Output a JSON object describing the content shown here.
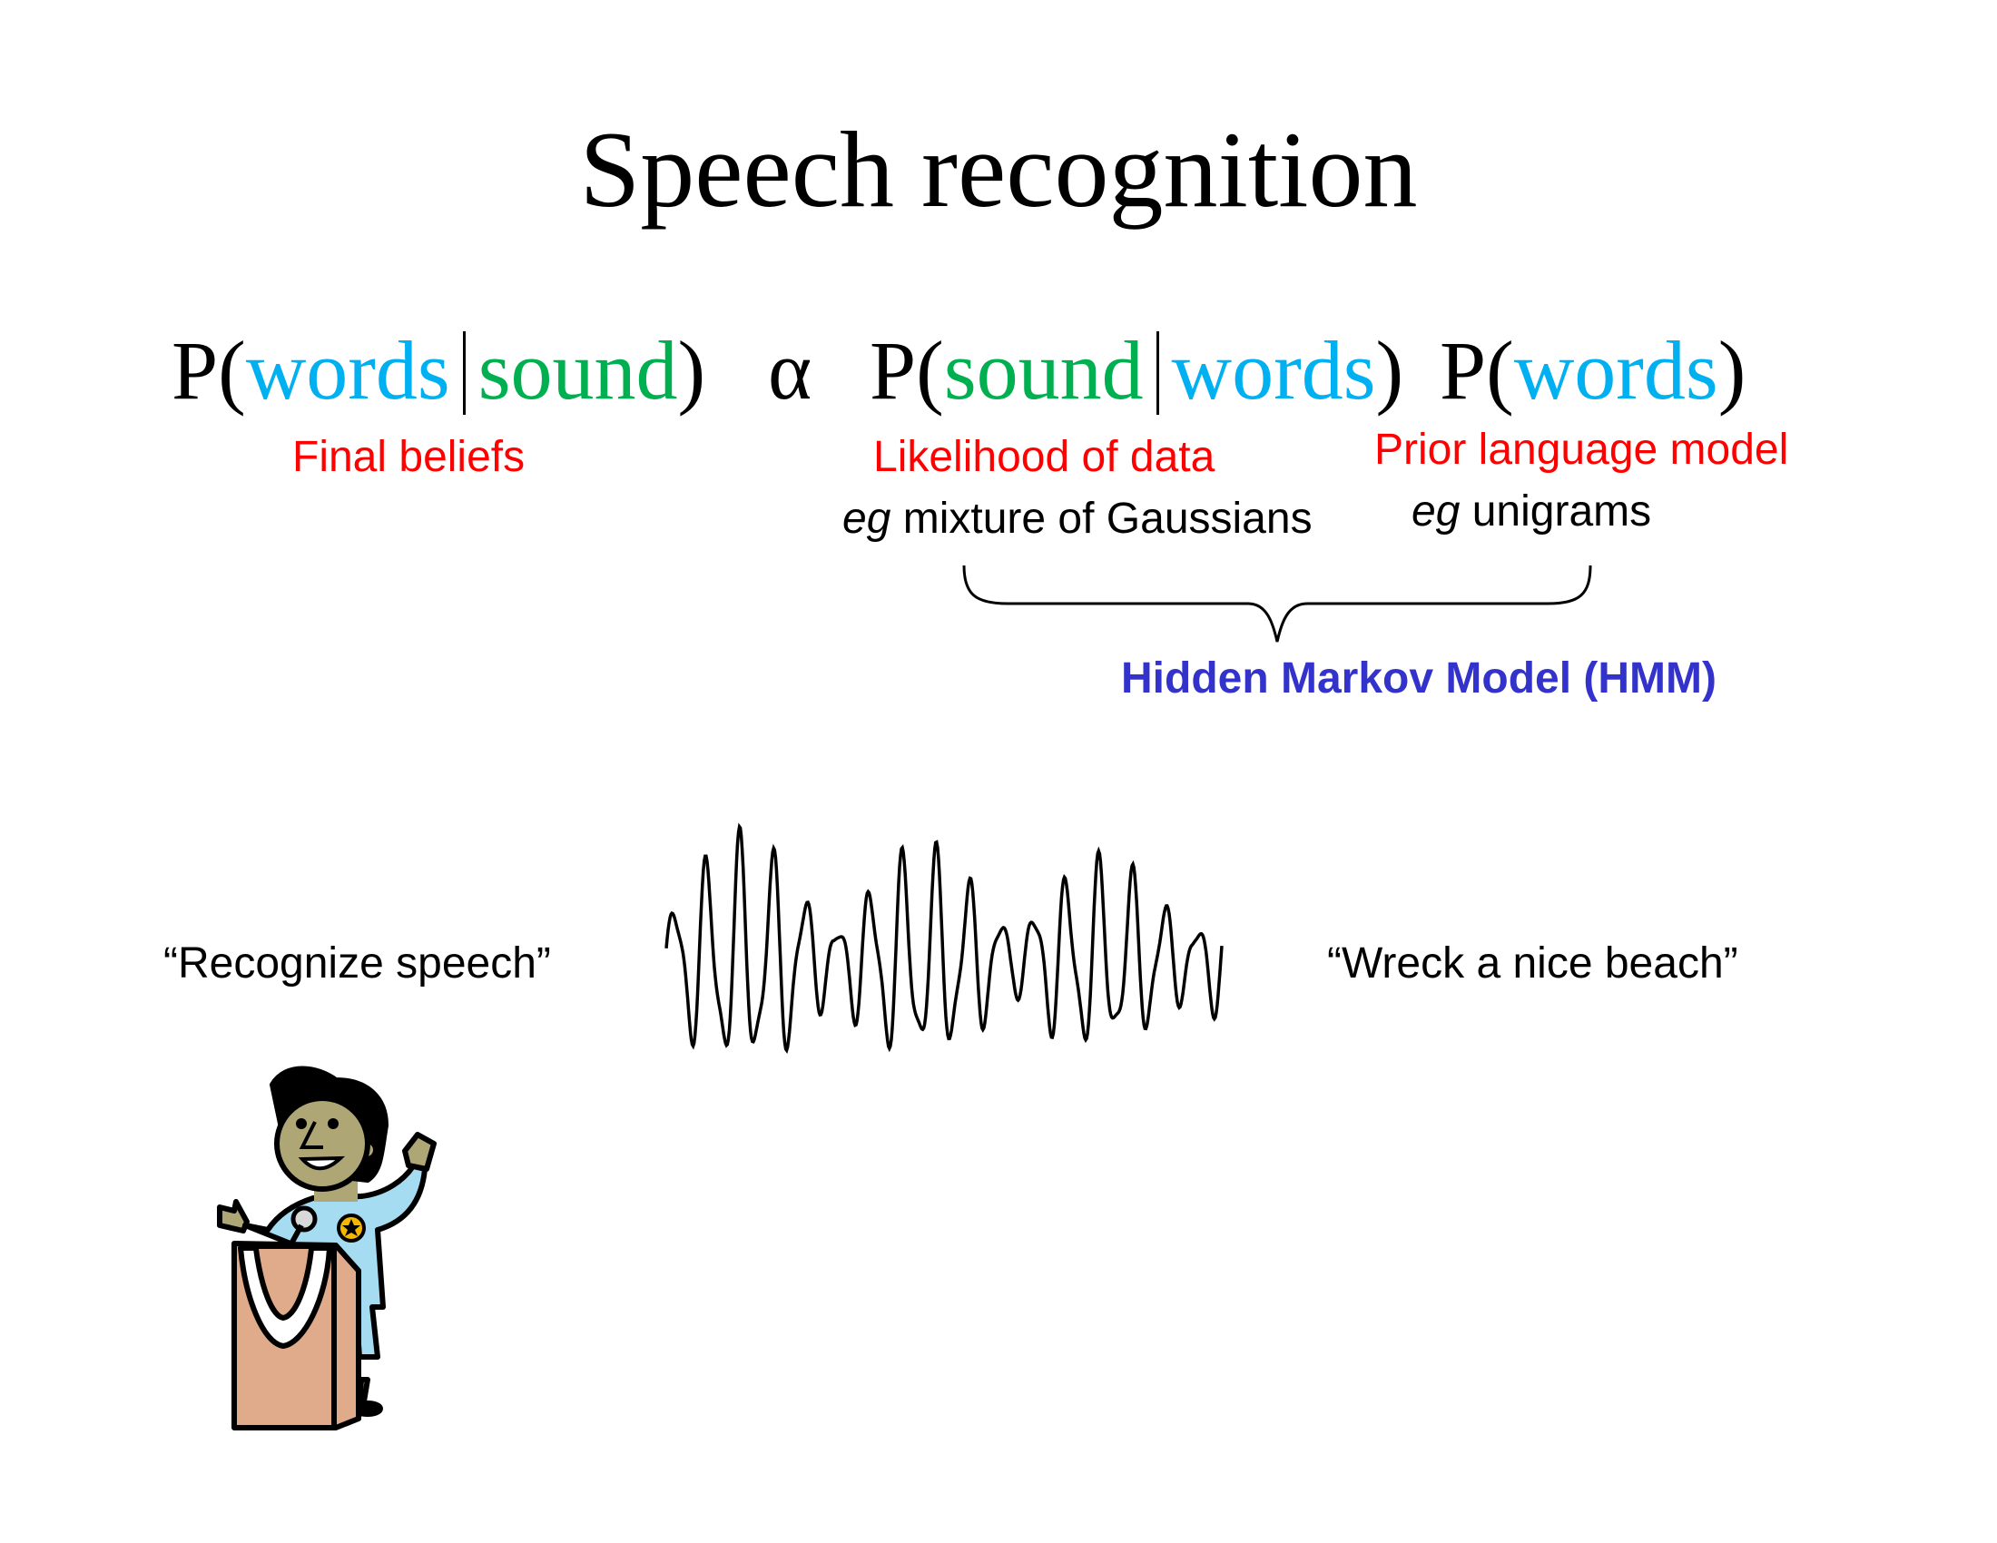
{
  "slide": {
    "title": "Speech recognition",
    "formula": {
      "lhs": {
        "p": "P(",
        "a": "words",
        "sep": "|",
        "b": "sound",
        "close": ")"
      },
      "proportional": "α",
      "likelihood": {
        "p": "P(",
        "a": "sound",
        "sep": "|",
        "b": "words",
        "close": ")"
      },
      "prior": {
        "p": "P(",
        "a": "words",
        "close": ")"
      }
    },
    "labels": {
      "final_beliefs": "Final beliefs",
      "likelihood": "Likelihood of data",
      "likelihood_eg": "eg",
      "likelihood_example": " mixture of Gaussians",
      "prior": "Prior language model",
      "prior_eg": "eg",
      "prior_example": " unigrams",
      "hmm": "Hidden Markov Model (HMM)"
    },
    "quotes": {
      "left": "“Recognize speech”",
      "right": "“Wreck a nice beach”"
    },
    "colors": {
      "words": "#00b0f0",
      "sound": "#00b050",
      "annotation": "#ff0000",
      "hmm": "#3333cc"
    },
    "images": [
      "speaker-at-podium-clipart",
      "sound-waveform"
    ]
  }
}
